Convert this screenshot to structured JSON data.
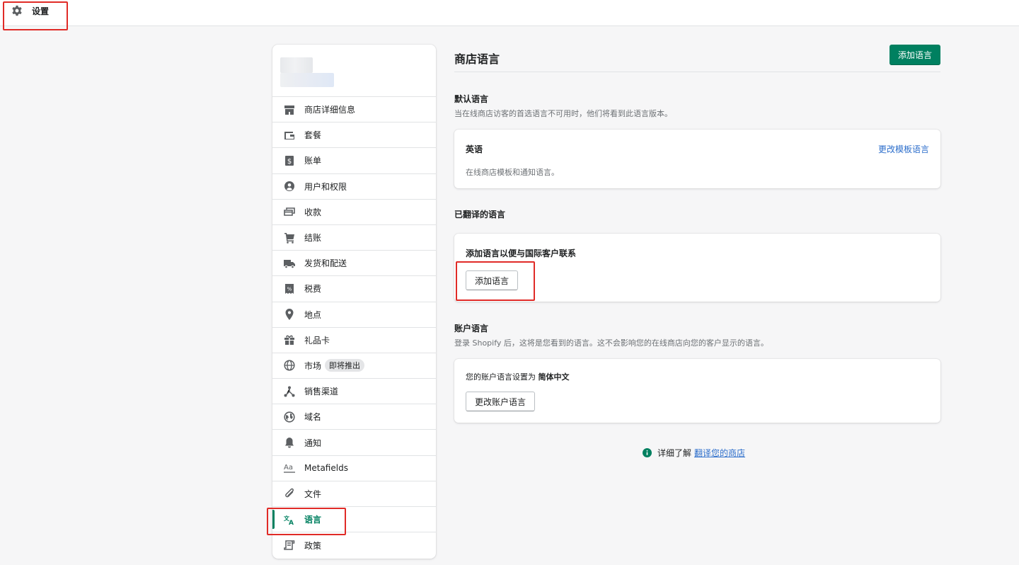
{
  "topbar": {
    "title": "设置"
  },
  "sidebar": {
    "items": [
      {
        "label": "商店详细信息",
        "icon": "store-icon"
      },
      {
        "label": "套餐",
        "icon": "plan-icon"
      },
      {
        "label": "账单",
        "icon": "billing-icon"
      },
      {
        "label": "用户和权限",
        "icon": "user-icon"
      },
      {
        "label": "收款",
        "icon": "payments-icon"
      },
      {
        "label": "结账",
        "icon": "cart-icon"
      },
      {
        "label": "发货和配送",
        "icon": "truck-icon"
      },
      {
        "label": "税费",
        "icon": "tax-icon"
      },
      {
        "label": "地点",
        "icon": "location-icon"
      },
      {
        "label": "礼品卡",
        "icon": "gift-icon"
      },
      {
        "label": "市场",
        "icon": "globe-icon",
        "badge": "即将推出"
      },
      {
        "label": "销售渠道",
        "icon": "channels-icon"
      },
      {
        "label": "域名",
        "icon": "domain-icon"
      },
      {
        "label": "通知",
        "icon": "bell-icon"
      },
      {
        "label": "Metafields",
        "icon": "metafields-icon"
      },
      {
        "label": "文件",
        "icon": "paperclip-icon"
      },
      {
        "label": "语言",
        "icon": "translate-icon",
        "active": true
      },
      {
        "label": "政策",
        "icon": "policy-icon"
      }
    ]
  },
  "main": {
    "title": "商店语言",
    "add_language_primary": "添加语言",
    "default_section": {
      "title": "默认语言",
      "subtitle": "当在线商店访客的首选语言不可用时，他们将看到此语言版本。",
      "card_title": "英语",
      "card_text": "在线商店模板和通知语言。",
      "link": "更改模板语言"
    },
    "translated_section": {
      "title": "已翻译的语言",
      "card_title": "添加语言以便与国际客户联系",
      "button": "添加语言"
    },
    "account_section": {
      "title": "账户语言",
      "subtitle": "登录 Shopify 后，这将是您看到的语言。这不会影响您的在线商店向您的客户显示的语言。",
      "card_text_prefix": "您的账户语言设置为",
      "card_text_value": "简体中文",
      "button": "更改账户语言"
    },
    "help": {
      "prefix": "详细了解",
      "link": "翻译您的商店"
    }
  },
  "colors": {
    "primary": "#008060",
    "link": "#2c6ecb",
    "highlight": "#e02b27"
  }
}
